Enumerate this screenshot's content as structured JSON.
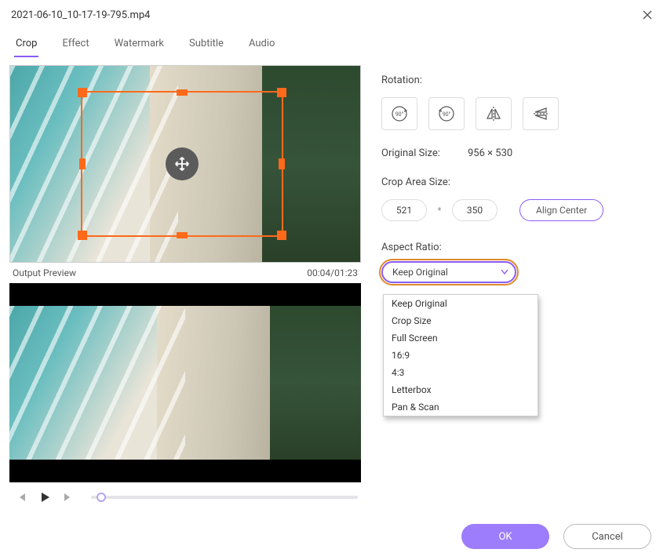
{
  "title": "2021-06-10_10-17-19-795.mp4",
  "tabs": {
    "crop": "Crop",
    "effect": "Effect",
    "watermark": "Watermark",
    "subtitle": "Subtitle",
    "audio": "Audio"
  },
  "preview": {
    "output_label": "Output Preview",
    "time": "00:04/01:23"
  },
  "rotation": {
    "label": "Rotation:"
  },
  "original_size": {
    "label": "Original Size:",
    "value": "956 × 530"
  },
  "crop_area": {
    "label": "Crop Area Size:",
    "width": "521",
    "height": "350",
    "align_center": "Align Center"
  },
  "aspect_ratio": {
    "label": "Aspect Ratio:",
    "selected": "Keep Original",
    "options": [
      "Keep Original",
      "Crop Size",
      "Full Screen",
      "16:9",
      "4:3",
      "Letterbox",
      "Pan & Scan"
    ]
  },
  "footer": {
    "ok": "OK",
    "cancel": "Cancel"
  }
}
